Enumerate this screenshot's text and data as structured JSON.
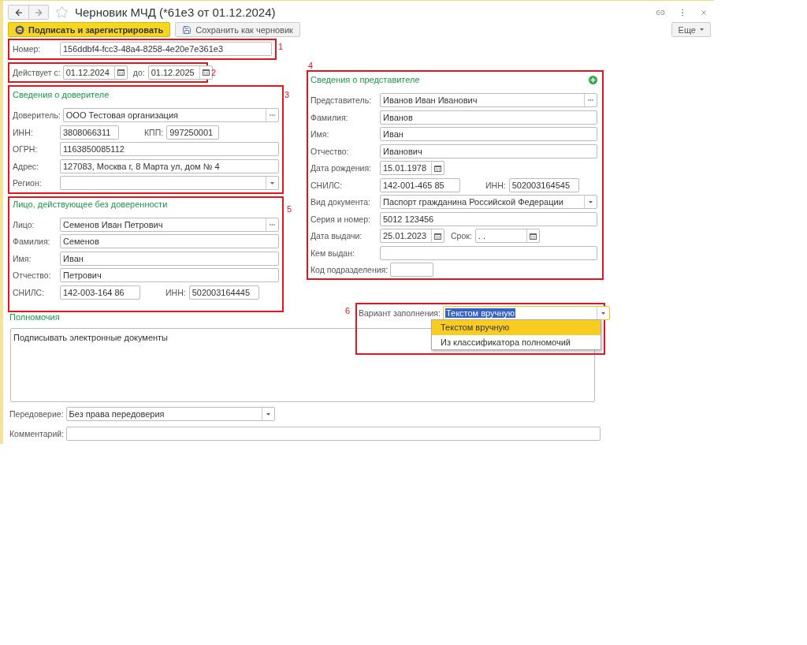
{
  "window": {
    "title": "Черновик МЧД (*61е3 от 01.12.2024)"
  },
  "toolbar": {
    "buttons": [
      {
        "label": "Подписать и зарегистрировать",
        "kind": "primary"
      },
      {
        "label": "Сохранить как черновик",
        "kind": "save"
      }
    ],
    "more": "Еще"
  },
  "number": {
    "annotation": "1",
    "label": "Номер:",
    "value": "156ddbf4-fcc3-48a4-8258-4e20e7e361e3"
  },
  "validity": {
    "annotation": "2",
    "from_label": "Действует с:",
    "from": "01.12.2024",
    "to_label": "до:",
    "to": "01.12.2025"
  },
  "principal": {
    "annotation": "3",
    "title": "Сведения о доверителе",
    "rows": [
      [
        {
          "label": "Доверитель:",
          "value": "ООО Тестовая организация",
          "kind": "pick"
        }
      ],
      [
        {
          "label": "ИНН:",
          "value": "3808066311",
          "kind": "short"
        },
        {
          "label": "КПП:",
          "value": "997250001",
          "kind": "short"
        }
      ],
      [
        {
          "label": "ОГРН:",
          "value": "1163850085112",
          "kind": "text"
        }
      ],
      [
        {
          "label": "Адрес:",
          "value": "127083, Москва г, 8 Марта ул, дом № 4",
          "kind": "text"
        }
      ],
      [
        {
          "label": "Регион:",
          "kind": "select"
        }
      ]
    ]
  },
  "person": {
    "annotation": "5",
    "title": "Лицо, действующее без доверенности",
    "rows": [
      [
        {
          "label": "Лицо:",
          "value": "Семенов Иван Петрович",
          "kind": "pick"
        }
      ],
      [
        {
          "label": "Фамилия:",
          "value": "Семенов",
          "kind": "text"
        }
      ],
      [
        {
          "label": "Имя:",
          "value": "Иван",
          "kind": "text"
        }
      ],
      [
        {
          "label": "Отчество:",
          "value": "Петрович",
          "kind": "text"
        }
      ],
      [
        {
          "label": "СНИЛС:",
          "value": "142-003-164 86",
          "kind": "short"
        },
        {
          "label": "ИНН:",
          "value": "502003164445",
          "kind": "short"
        }
      ]
    ]
  },
  "representative": {
    "annotation": "4",
    "title": "Сведения о представителе",
    "rows": [
      [
        {
          "label": "Представитель:",
          "value": "Иванов Иван Иванович",
          "kind": "pick"
        }
      ],
      [
        {
          "label": "Фамилия:",
          "value": "Иванов",
          "kind": "text"
        }
      ],
      [
        {
          "label": "Имя:",
          "value": "Иван",
          "kind": "text"
        }
      ],
      [
        {
          "label": "Отчество:",
          "value": "Иванович",
          "kind": "text"
        }
      ],
      [
        {
          "label": "Дата рождения:",
          "value": "15.01.1978",
          "kind": "date"
        }
      ],
      [
        {
          "label": "СНИЛС:",
          "value": "142-001-465 85",
          "kind": "short"
        },
        {
          "label": "ИНН:",
          "value": "502003164545",
          "kind": "short"
        }
      ],
      [
        {
          "label": "Вид документа:",
          "value": "Паспорт гражданина Российской Федерации",
          "kind": "select"
        }
      ],
      [
        {
          "label": "Серия и номер:",
          "value": "5012 123456",
          "kind": "text"
        }
      ],
      [
        {
          "label": "Дата выдачи:",
          "value": "25.01.2023",
          "kind": "date"
        },
        {
          "label": "Срок:",
          "value": " .  .",
          "kind": "date"
        }
      ],
      [
        {
          "label": "Кем выдан:",
          "kind": "text"
        }
      ],
      [
        {
          "label": "Код подразделения:",
          "kind": "tiny"
        }
      ]
    ]
  },
  "powers": {
    "title": "Полномочия",
    "text": "Подписывать электронные документы"
  },
  "fill_variant": {
    "annotation": "6",
    "label": "Вариант заполнения:",
    "value": "Текстом вручную",
    "options": [
      {
        "label": "Текстом вручную",
        "selected": true
      },
      {
        "label": "Из классификатора полномочий",
        "selected": false
      }
    ]
  },
  "redelegation": {
    "label": "Передоверие:",
    "value": "Без права передоверия"
  },
  "comment": {
    "label": "Комментарий:"
  }
}
